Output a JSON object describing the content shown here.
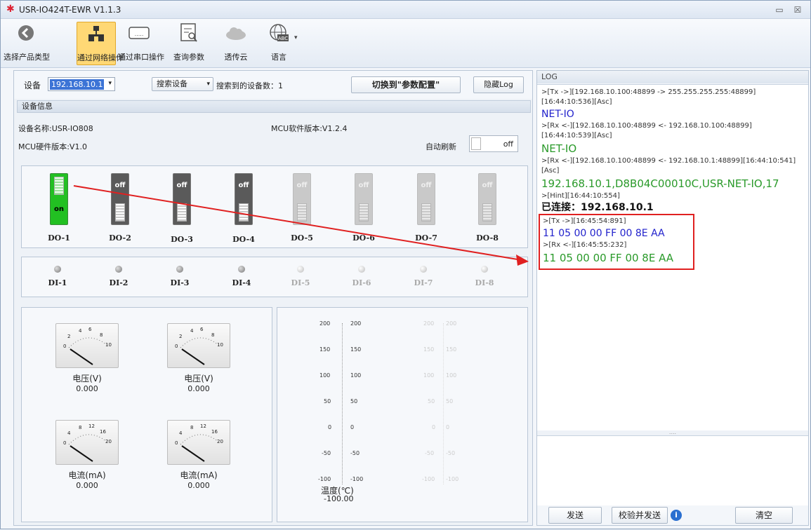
{
  "window": {
    "title": "USR-IO424T-EWR V1.1.3",
    "minimize": "▭",
    "close": "☒"
  },
  "toolbar": [
    {
      "label": "选择产品类型",
      "icon": "back-arrow-icon"
    },
    {
      "label": "通过网络操作",
      "icon": "network-icon",
      "active": true
    },
    {
      "label": "通过串口操作",
      "icon": "serial-port-icon"
    },
    {
      "label": "查询参数",
      "icon": "query-document-icon"
    },
    {
      "label": "透传云",
      "icon": "cloud-icon"
    },
    {
      "label": "语言",
      "icon": "language-globe-icon"
    }
  ],
  "device_bar": {
    "device_label": "设备",
    "device_value": "192.168.10.1",
    "search_btn": "搜索设备",
    "found_text": "搜索到的设备数：1",
    "switch_btn": "切换到\"参数配置\"",
    "hide_log_btn": "隐藏Log"
  },
  "device_info": {
    "header": "设备信息",
    "name": "设备名称:USR-IO808",
    "mcu_sw": "MCU软件版本:V1.2.4",
    "mcu_hw": "MCU硬件版本:V1.0",
    "auto_refresh_label": "自动刷新",
    "auto_refresh_state": "off"
  },
  "do_switches": [
    {
      "label": "DO-1",
      "state": "on"
    },
    {
      "label": "DO-2",
      "state": "off"
    },
    {
      "label": "DO-3",
      "state": "off"
    },
    {
      "label": "DO-4",
      "state": "off"
    },
    {
      "label": "DO-5",
      "state": "off"
    },
    {
      "label": "DO-6",
      "state": "off"
    },
    {
      "label": "DO-7",
      "state": "off"
    },
    {
      "label": "DO-8",
      "state": "off"
    }
  ],
  "di_inputs": [
    "DI-1",
    "DI-2",
    "DI-3",
    "DI-4",
    "DI-5",
    "DI-6",
    "DI-7",
    "DI-8"
  ],
  "meters": [
    {
      "title": "电压(V)",
      "value": "0.000",
      "ticks": [
        "0",
        "2",
        "4",
        "6",
        "8",
        "10"
      ]
    },
    {
      "title": "电压(V)",
      "value": "0.000",
      "ticks": [
        "0",
        "2",
        "4",
        "6",
        "8",
        "10"
      ]
    },
    {
      "title": "电流(mA)",
      "value": "0.000",
      "ticks": [
        "0",
        "4",
        "8",
        "12",
        "16",
        "20"
      ]
    },
    {
      "title": "电流(mA)",
      "value": "0.000",
      "ticks": [
        "0",
        "4",
        "8",
        "12",
        "16",
        "20"
      ]
    }
  ],
  "thermometer": {
    "ticks": [
      "200",
      "150",
      "100",
      "50",
      "0",
      "-50",
      "-100"
    ],
    "title": "温度(℃)",
    "value": "-100.00"
  },
  "log": {
    "header": "LOG",
    "entries": [
      {
        "type": "g",
        "text": ">[Tx ->][192.168.10.100:48899 -> 255.255.255.255:48899]"
      },
      {
        "type": "g",
        "text": "[16:44:10:536][Asc]"
      },
      {
        "type": "blue",
        "text": "NET-IO"
      },
      {
        "type": "g",
        "text": ">[Rx <-][192.168.10.100:48899 <- 192.168.10.100:48899]"
      },
      {
        "type": "g",
        "text": "[16:44:10:539][Asc]"
      },
      {
        "type": "green",
        "text": "NET-IO"
      },
      {
        "type": "g",
        "text": ">[Rx <-][192.168.10.100:48899 <- 192.168.10.1:48899][16:44:10:541]"
      },
      {
        "type": "g",
        "text": "[Asc]"
      },
      {
        "type": "green",
        "text": "192.168.10.1,D8B04C00010C,USR-NET-IO,17"
      },
      {
        "type": "g",
        "text": ">[Hint][16:44:10:554]"
      },
      {
        "type": "bold",
        "text": "已连接：192.168.10.1"
      },
      {
        "type": "g",
        "text": ">[Tx ->][16:45:54:891]"
      },
      {
        "type": "blue",
        "text": "11 05 00 00 FF 00 8E AA"
      },
      {
        "type": "g",
        "text": ">[Rx <-][16:45:55:232]"
      },
      {
        "type": "green",
        "text": "11 05 00 00 FF 00 8E AA"
      }
    ],
    "splitter": "....",
    "send_btn": "发送",
    "check_send_btn": "校验并发送",
    "clear_btn": "清空"
  },
  "colors": {
    "tx": "#2222cc",
    "rx": "#2a9a2a",
    "highlight": "#e02020",
    "on_green": "#22c022"
  }
}
